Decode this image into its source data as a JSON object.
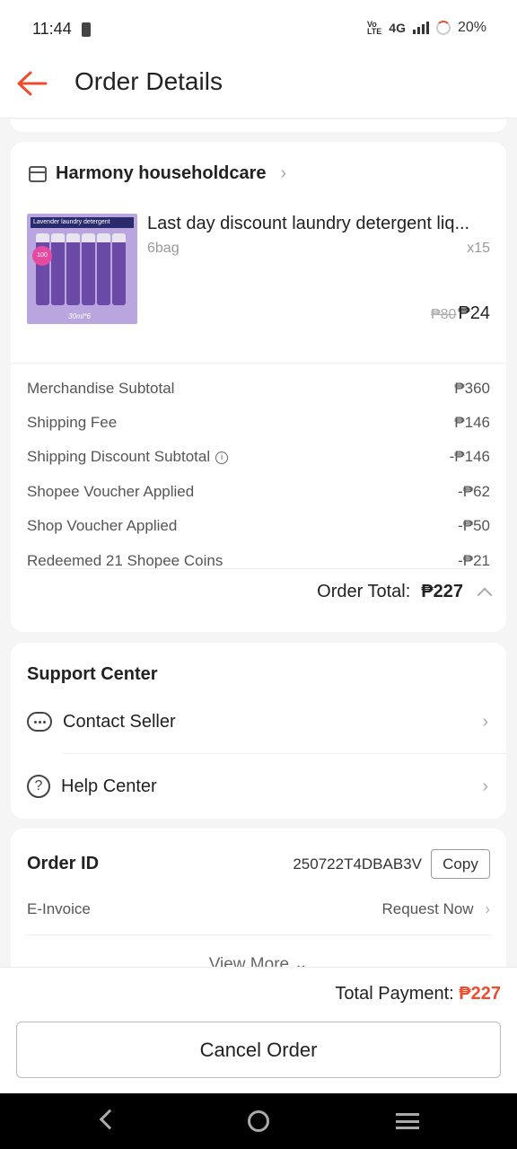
{
  "status_bar": {
    "time": "11:44",
    "network": "4G",
    "battery": "20%"
  },
  "header": {
    "title": "Order Details"
  },
  "shop": {
    "name": "Harmony householdcare",
    "product": {
      "image_banner": "Lavender laundry detergent",
      "image_caption": "30ml*6",
      "image_badge": "100",
      "title": "Last day discount laundry detergent liq...",
      "variant": "6bag",
      "quantity": "x15",
      "original_price": "₱80",
      "price": "₱24"
    },
    "summary": [
      {
        "label": "Merchandise Subtotal",
        "value": "₱360"
      },
      {
        "label": "Shipping Fee",
        "value": "₱146"
      },
      {
        "label": "Shipping Discount Subtotal",
        "value": "-₱146"
      },
      {
        "label": "Shopee Voucher Applied",
        "value": "-₱62"
      },
      {
        "label": "Shop Voucher Applied",
        "value": "-₱50"
      },
      {
        "label": "Redeemed 21 Shopee Coins",
        "value": "-₱21"
      }
    ],
    "order_total_label": "Order Total:",
    "order_total": "₱227"
  },
  "support": {
    "title": "Support Center",
    "contact_seller": "Contact Seller",
    "help_center": "Help Center"
  },
  "order": {
    "id_label": "Order ID",
    "id_value": "250722T4DBAB3V",
    "copy_label": "Copy",
    "einvoice_label": "E-Invoice",
    "einvoice_action": "Request Now",
    "view_more": "View More"
  },
  "footer": {
    "payment_label": "Total Payment:",
    "payment_amount": "₱227",
    "cancel_label": "Cancel Order"
  },
  "colors": {
    "accent": "#ee4d2d"
  }
}
